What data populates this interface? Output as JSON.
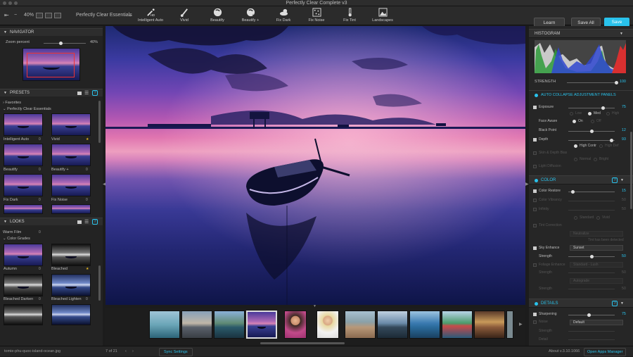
{
  "window": {
    "title": "Perfectly Clear Complete v3"
  },
  "toolbar": {
    "zoom": "40%",
    "preset_name": "Perfectly Clear Essentials",
    "tools": [
      {
        "label": "Intelligent Auto",
        "icon": "wand-hd-icon"
      },
      {
        "label": "Vivid",
        "icon": "brush-icon"
      },
      {
        "label": "Beautify",
        "icon": "face-icon"
      },
      {
        "label": "Beautify +",
        "icon": "face-plus-icon"
      },
      {
        "label": "Fix Dark",
        "icon": "cloud-sun-icon"
      },
      {
        "label": "Fix Noise",
        "icon": "noise-icon"
      },
      {
        "label": "Fix Tint",
        "icon": "thermometer-icon"
      },
      {
        "label": "Landscapes",
        "icon": "landscape-icon"
      }
    ],
    "learn": "Learn",
    "save_all": "Save All",
    "save": "Save"
  },
  "navigator": {
    "title": "NAVIGATOR",
    "zoom_label": "Zoom percent",
    "zoom_value": "40%",
    "zoom_fraction": 0.4
  },
  "presets": {
    "title": "PRESETS",
    "favorites": "Favorites",
    "group": "Perfectly Clear Essentials",
    "items": [
      {
        "name": "Intelligent Auto",
        "count": "0",
        "star": false
      },
      {
        "name": "Vivid",
        "count": "",
        "star": true
      },
      {
        "name": "Beautify",
        "count": "0",
        "star": false
      },
      {
        "name": "Beautify +",
        "count": "0",
        "star": false
      },
      {
        "name": "Fix Dark",
        "count": "0",
        "star": false
      },
      {
        "name": "Fix Noise",
        "count": "0",
        "star": false
      }
    ]
  },
  "looks": {
    "title": "LOOKS",
    "warm_film": "Warm Film",
    "warm_film_count": "0",
    "group": "Color Grades",
    "items": [
      {
        "name": "Autumn",
        "count": "0",
        "star": false,
        "style": "color"
      },
      {
        "name": "Bleached",
        "count": "",
        "star": true,
        "style": "bw"
      },
      {
        "name": "Bleached Darken",
        "count": "0",
        "star": false,
        "style": "bw"
      },
      {
        "name": "Bleached Lighten",
        "count": "0",
        "star": false,
        "style": "blue"
      }
    ]
  },
  "right": {
    "histogram": "HISTOGRAM",
    "strength_label": "STRENGTH",
    "strength_value": "100",
    "strength_fraction": 1.0,
    "auto_collapse": "AUTO COLLAPSE ADJUSTMENT PANELS",
    "exposure": {
      "label": "Exposure",
      "value": "75",
      "fraction": 0.75,
      "options": [
        "Low",
        "Med",
        "High"
      ]
    },
    "face_aware": {
      "label": "Face Aware",
      "options": [
        "On",
        "Off"
      ]
    },
    "black_point": {
      "label": "Black Point",
      "value": "12",
      "fraction": 0.5
    },
    "depth": {
      "label": "Depth",
      "value": "93",
      "fraction": 0.93,
      "options": [
        "High Contr",
        "High Def"
      ]
    },
    "skin_depth_bias": {
      "label": "Skin & Depth Bias",
      "options": [
        "Normal",
        "Bright"
      ]
    },
    "light_diffusion": {
      "label": "Light Diffusion"
    },
    "color": {
      "title": "COLOR"
    },
    "color_restore": {
      "label": "Color Restore",
      "value": "15",
      "fraction": 0.1
    },
    "color_vibrancy": {
      "label": "Color Vibrancy",
      "value": "50"
    },
    "infinity": {
      "label": "Infinity",
      "value": "50"
    },
    "infinity_options": [
      "Standard",
      "Vivid"
    ],
    "tint_correction": {
      "label": "Tint Correction",
      "select": "Neutralize"
    },
    "tint_note": "Tint has been detected",
    "sky_enhance": {
      "label": "Sky Enhance",
      "select": "Sunset"
    },
    "sky_strength": {
      "label": "Strength",
      "value": "50",
      "fraction": 0.5
    },
    "foliage_enhance": {
      "label": "Foliage Enhance",
      "select": "Standard - Lush"
    },
    "foliage_strength": {
      "label": "Strength",
      "value": "50"
    },
    "foliage_select2": "Autograde",
    "foliage_strength2": {
      "label": "Strength",
      "value": "50"
    },
    "details": {
      "title": "DETAILS"
    },
    "sharpening": {
      "label": "Sharpening",
      "value": "75",
      "fraction": 0.45
    },
    "noise": {
      "label": "Noise",
      "select": "Default"
    },
    "noise_strength": {
      "label": "Strength",
      "value": ""
    },
    "noise_detail": {
      "label": "Detail",
      "value": ""
    }
  },
  "status": {
    "filename": "tomie-phu-quoc-island-ocean.jpg",
    "position": "7 of 21",
    "sync": "Sync Settings",
    "about": "About v.3.10.1066",
    "open_apps": "Open Apps Manager"
  },
  "colors": {
    "accent": "#29c2ec",
    "save": "#29c2ec"
  }
}
